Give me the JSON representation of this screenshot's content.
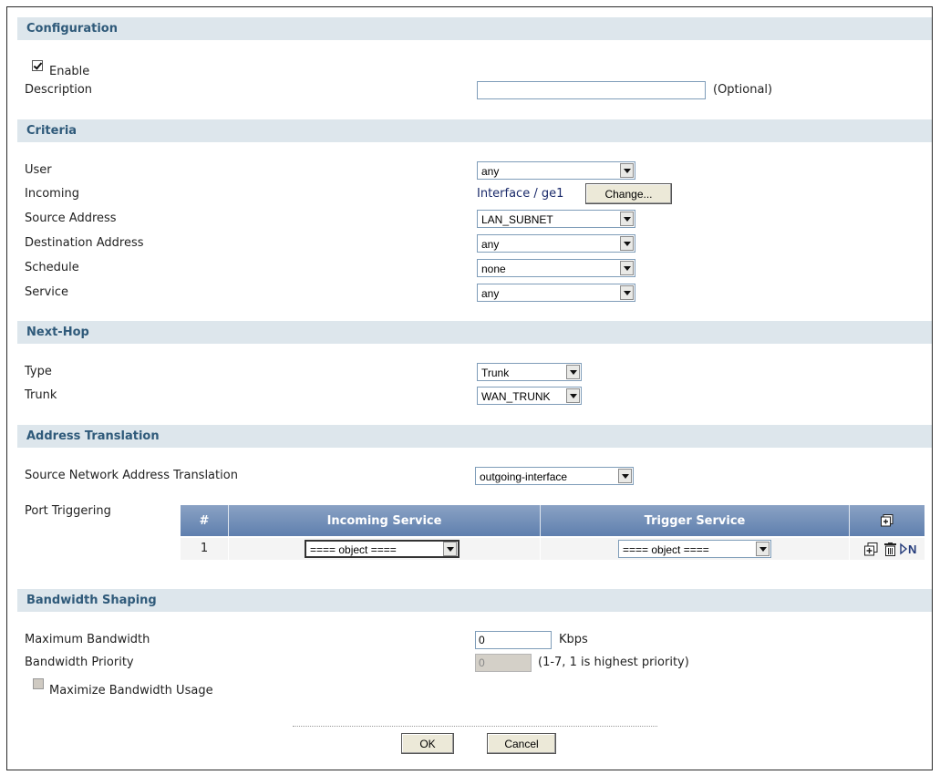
{
  "sections": {
    "configuration": "Configuration",
    "criteria": "Criteria",
    "next_hop": "Next-Hop",
    "address_translation": "Address Translation",
    "bandwidth_shaping": "Bandwidth Shaping"
  },
  "configuration": {
    "enable_label": "Enable",
    "enable_checked": true,
    "description_label": "Description",
    "description_value": "",
    "description_hint": "(Optional)"
  },
  "criteria": {
    "user_label": "User",
    "user_value": "any",
    "incoming_label": "Incoming",
    "incoming_value": "Interface / ge1",
    "change_button": "Change...",
    "source_label": "Source Address",
    "source_value": "LAN_SUBNET",
    "destination_label": "Destination Address",
    "destination_value": "any",
    "schedule_label": "Schedule",
    "schedule_value": "none",
    "service_label": "Service",
    "service_value": "any"
  },
  "next_hop": {
    "type_label": "Type",
    "type_value": "Trunk",
    "trunk_label": "Trunk",
    "trunk_value": "WAN_TRUNK"
  },
  "address_translation": {
    "snat_label": "Source Network Address Translation",
    "snat_value": "outgoing-interface",
    "port_triggering_label": "Port Triggering",
    "table": {
      "columns": [
        "#",
        "Incoming Service",
        "Trigger Service"
      ],
      "rows": [
        {
          "index": "1",
          "incoming": "==== object ====",
          "trigger": "==== object ===="
        }
      ]
    }
  },
  "bandwidth": {
    "max_label": "Maximum Bandwidth",
    "max_value": "0",
    "max_unit": "Kbps",
    "priority_label": "Bandwidth Priority",
    "priority_value": "0",
    "priority_hint": "(1-7, 1 is highest priority)",
    "maximize_label": "Maximize Bandwidth Usage",
    "maximize_checked": false
  },
  "buttons": {
    "ok": "OK",
    "cancel": "Cancel"
  },
  "icons": {
    "add": "add-icon",
    "insert": "insert-icon",
    "delete": "delete-icon",
    "move": "move-icon"
  },
  "colors": {
    "section_bg": "#dde6ec",
    "section_text": "#2f5a7a",
    "table_header": "#6f8db8"
  }
}
